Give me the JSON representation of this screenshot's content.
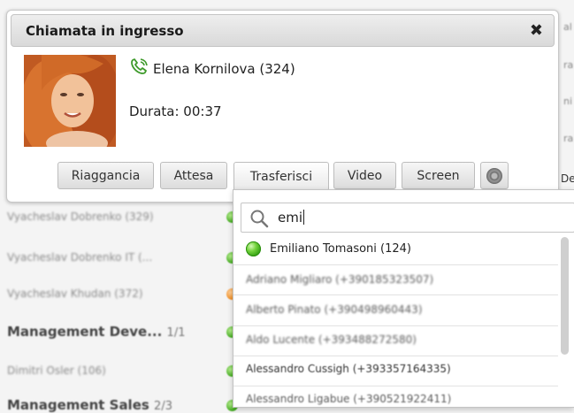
{
  "background_list": {
    "rows": [
      {
        "text": "Vyacheslav Dobrenko (329)",
        "type": "contact",
        "status": "green"
      },
      {
        "text": "Vyacheslav Dobrenko IT (...",
        "type": "contact",
        "status": "green"
      },
      {
        "text": "Vyacheslav Khudan (372)",
        "type": "contact",
        "status": "orange"
      },
      {
        "text": "Management Deve...",
        "count": "1/1",
        "type": "group",
        "status": "green"
      },
      {
        "text": "Dimitri Osler (106)",
        "type": "contact",
        "status": "green"
      },
      {
        "text": "Management Sales",
        "count": "2/3",
        "type": "group",
        "status": "green"
      }
    ],
    "right_fragments": [
      "al",
      "ra",
      "ni",
      "ra",
      "De"
    ]
  },
  "call": {
    "title": "Chiamata in ingresso",
    "close_symbol": "✖",
    "caller": "Elena Kornilova (324)",
    "duration": "Durata: 00:37",
    "buttons": {
      "hangup": "Riaggancia",
      "hold": "Attesa",
      "transfer": "Trasferisci",
      "video": "Video",
      "screen": "Screen"
    }
  },
  "transfer": {
    "search_value": "emi",
    "results": [
      {
        "label": "Emiliano Tomasoni (124)",
        "status": "online"
      },
      {
        "label": "Adriano Migliaro (+390185323507)"
      },
      {
        "label": "Alberto Pinato (+390498960443)"
      },
      {
        "label": "Aldo Lucente (+393488272580)"
      },
      {
        "label": "Alessandro Cussigh (+393357164335)"
      },
      {
        "label": "Alessandro Ligabue (+390521922411)"
      }
    ]
  },
  "colors": {
    "online": "#4cbf1f",
    "busy": "#f08a1c",
    "header_bg": "#e3e3e3"
  },
  "icons": {
    "phone": "phone-handset-icon",
    "search": "magnifier-icon",
    "record": "record-icon",
    "close": "close-icon"
  }
}
